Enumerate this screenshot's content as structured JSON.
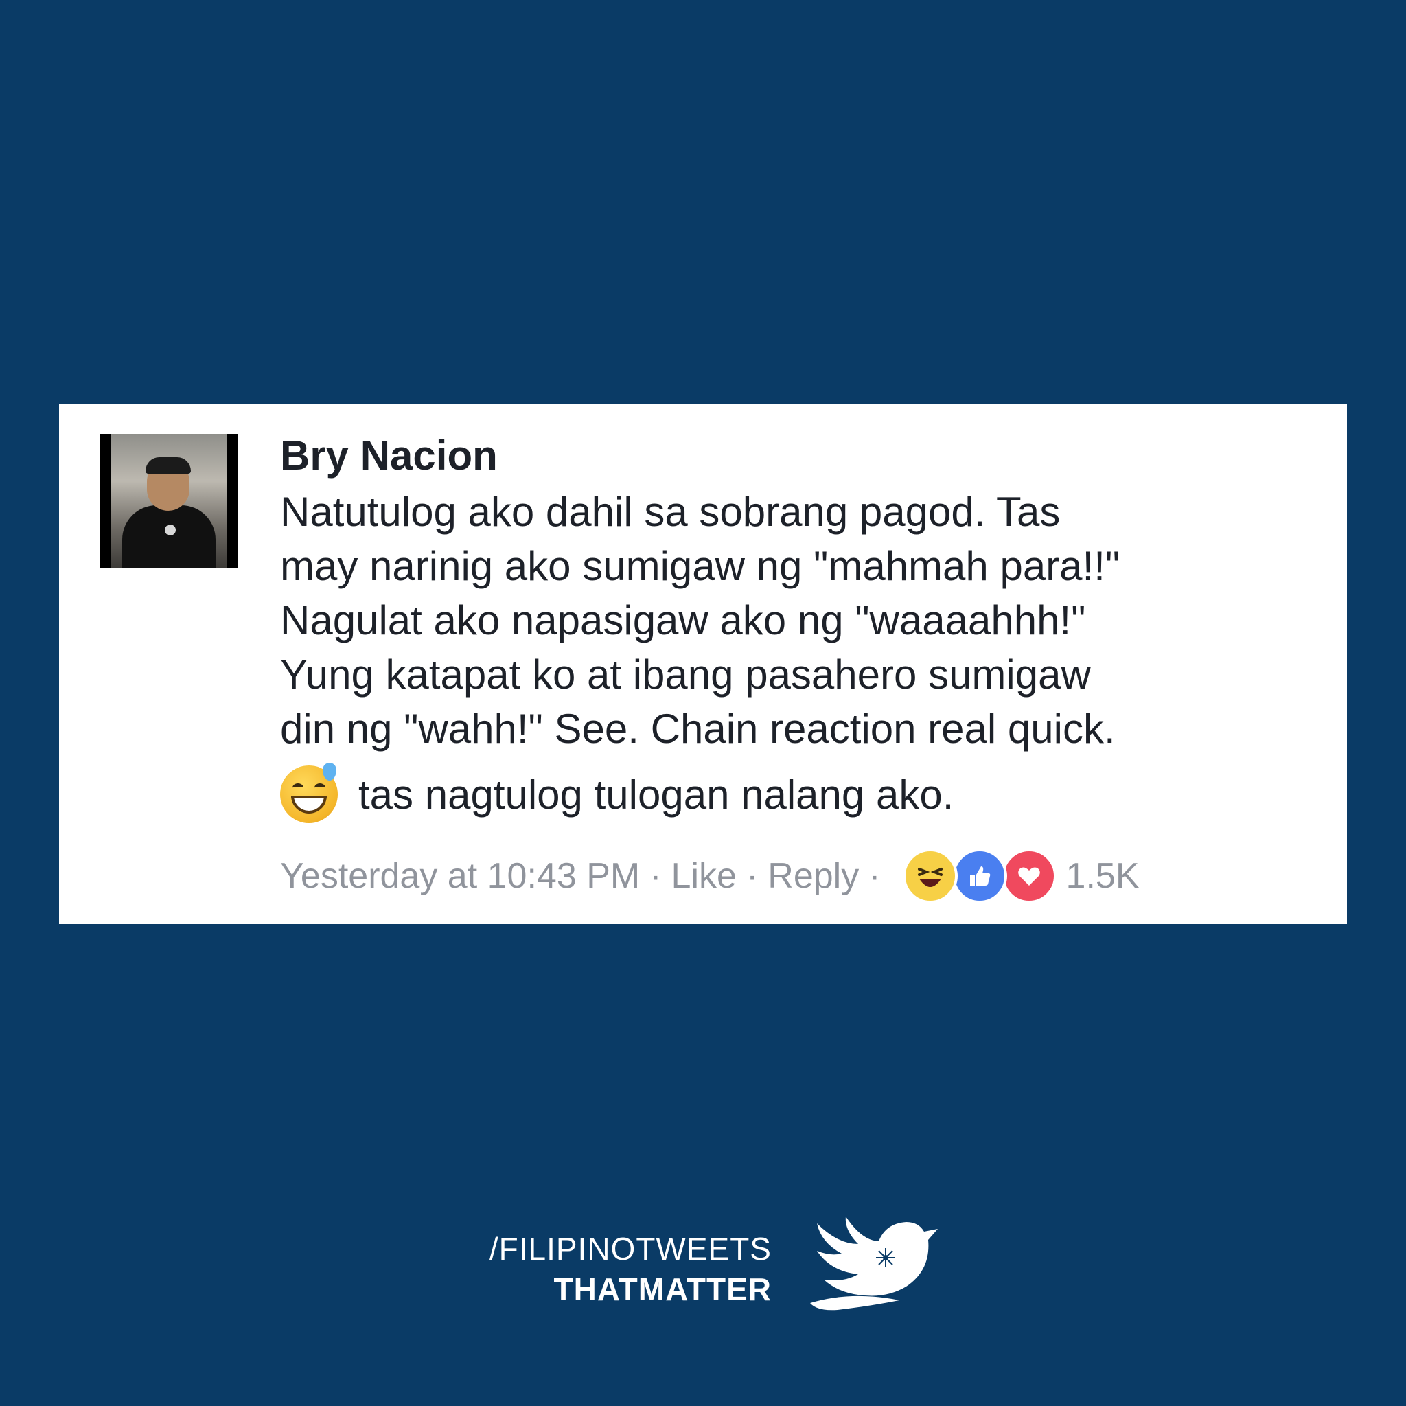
{
  "comment": {
    "author": "Bry Nacion",
    "lines": [
      "Natutulog ako dahil sa sobrang pagod. Tas",
      "may narinig ako sumigaw ng \"mahmah para!!\"",
      "Nagulat ako napasigaw ako ng \"waaaahhh!\"",
      "Yung katapat ko at ibang pasahero sumigaw",
      "din ng \"wahh!\" See. Chain reaction real quick."
    ],
    "extra_text": "tas nagtulog tulogan nalang ako.",
    "extra_emoji": "grinning-sweat-emoji"
  },
  "meta": {
    "timestamp": "Yesterday at 10:43 PM",
    "separator": "·",
    "like_label": "Like",
    "reply_label": "Reply",
    "reaction_icons": [
      "haha-icon",
      "like-icon",
      "love-icon"
    ],
    "reaction_count": "1.5K"
  },
  "brand": {
    "line1": "/FILIPINOTWEETS",
    "line2": "THATMATTER"
  },
  "colors": {
    "background": "#0a3b66",
    "card": "#ffffff",
    "text": "#1d2129",
    "meta": "#90949c",
    "like": "#4a7ff0",
    "love": "#f0495e",
    "haha": "#f7d046"
  }
}
